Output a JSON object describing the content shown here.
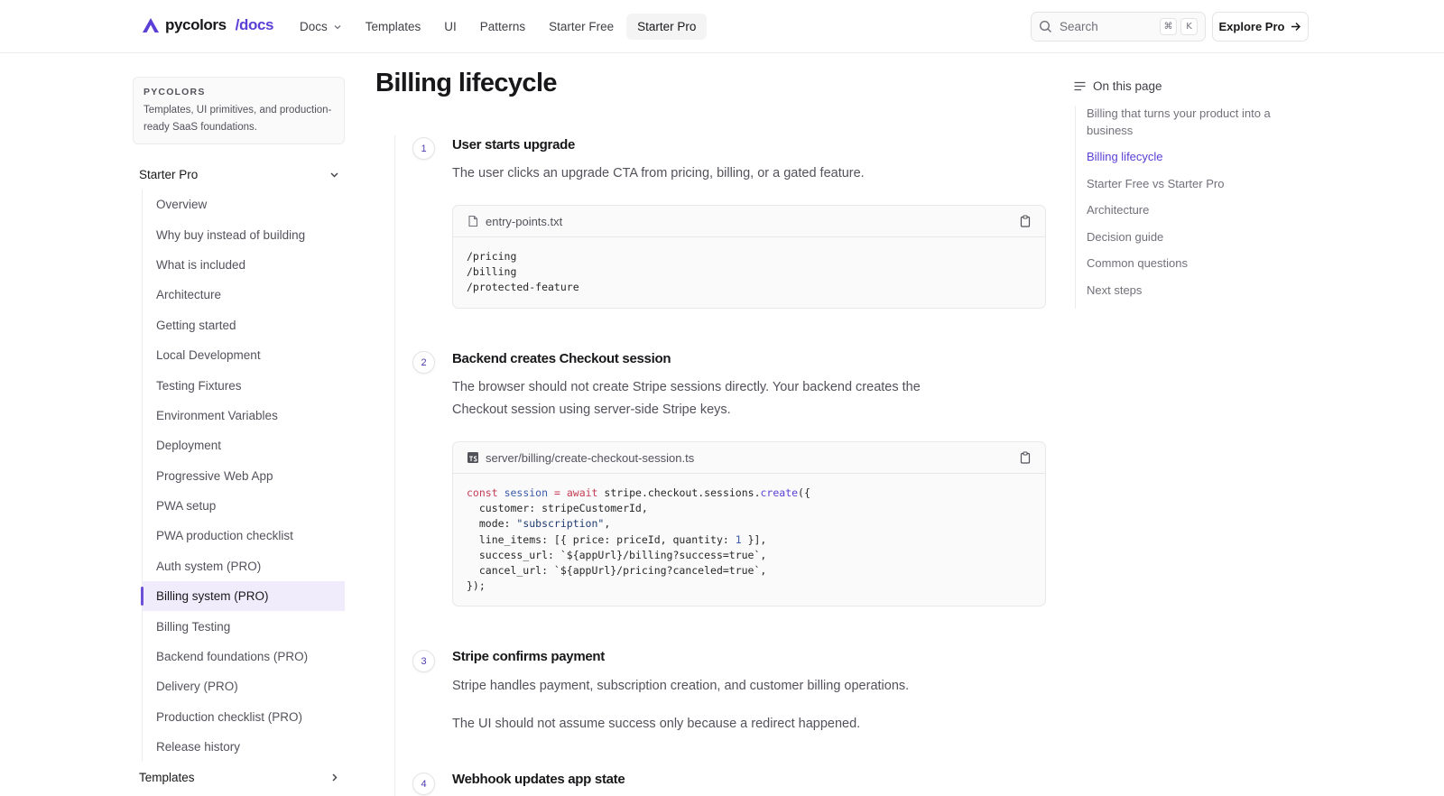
{
  "header": {
    "brand_name": "pycolors",
    "brand_docs": "/docs",
    "nav": [
      {
        "label": "Docs",
        "has_menu": true,
        "active": false
      },
      {
        "label": "Templates",
        "active": false
      },
      {
        "label": "UI",
        "active": false
      },
      {
        "label": "Patterns",
        "active": false
      },
      {
        "label": "Starter Free",
        "active": false
      },
      {
        "label": "Starter Pro",
        "active": true
      }
    ],
    "search": {
      "placeholder": "Search",
      "shortcut_mod": "⌘",
      "shortcut_key": "K"
    },
    "cta": "Explore Pro"
  },
  "sidebar": {
    "intro": {
      "eyebrow": "PYCOLORS",
      "text": "Templates, UI primitives, and production-ready SaaS foundations."
    },
    "group": "Starter Pro",
    "items": [
      "Overview",
      "Why buy instead of building",
      "What is included",
      "Architecture",
      "Getting started",
      "Local Development",
      "Testing Fixtures",
      "Environment Variables",
      "Deployment",
      "Progressive Web App",
      "PWA setup",
      "PWA production checklist",
      "Auth system (PRO)",
      "Billing system (PRO)",
      "Billing Testing",
      "Backend foundations (PRO)",
      "Delivery (PRO)",
      "Production checklist (PRO)",
      "Release history"
    ],
    "active_item": "Billing system (PRO)",
    "next_group": "Templates"
  },
  "main": {
    "title": "Billing lifecycle",
    "steps": [
      {
        "num": "1",
        "title": "User starts upgrade",
        "desc": "The user clicks an upgrade CTA from pricing, billing, or a gated feature.",
        "file": "entry-points.txt",
        "code_lines": [
          "/pricing",
          "/billing",
          "/protected-feature"
        ]
      },
      {
        "num": "2",
        "title": "Backend creates Checkout session",
        "desc": "The browser should not create Stripe sessions directly. Your backend creates the Checkout session using server-side Stripe keys.",
        "file": "server/billing/create-checkout-session.ts",
        "code": {
          "kw_const": "const",
          "var_session": "session",
          "op_eq": "=",
          "kw_await": "await",
          "obj_chain": "stripe.checkout.sessions.",
          "fn_create": "create",
          "open": "({",
          "l2": "  customer: stripeCustomerId,",
          "l3_key": "  mode: ",
          "l3_str": "\"subscription\"",
          "l3_end": ",",
          "l4_pre": "  line_items: [{ price: priceId, quantity: ",
          "l4_num": "1",
          "l4_end": " }],",
          "l5": "  success_url: `${appUrl}/billing?success=true`,",
          "l6": "  cancel_url: `${appUrl}/pricing?canceled=true`,",
          "l7": "});"
        }
      },
      {
        "num": "3",
        "title": "Stripe confirms payment",
        "desc": "Stripe handles payment, subscription creation, and customer billing operations.",
        "desc2": "The UI should not assume success only because a redirect happened."
      },
      {
        "num": "4",
        "title": "Webhook updates app state"
      }
    ]
  },
  "toc": {
    "heading": "On this page",
    "items": [
      "Billing that turns your product into a business",
      "Billing lifecycle",
      "Starter Free vs Starter Pro",
      "Architecture",
      "Decision guide",
      "Common questions",
      "Next steps"
    ],
    "active": "Billing lifecycle"
  },
  "colors": {
    "accent": "#5b3fd6",
    "active_bg": "#f0ecfb"
  }
}
